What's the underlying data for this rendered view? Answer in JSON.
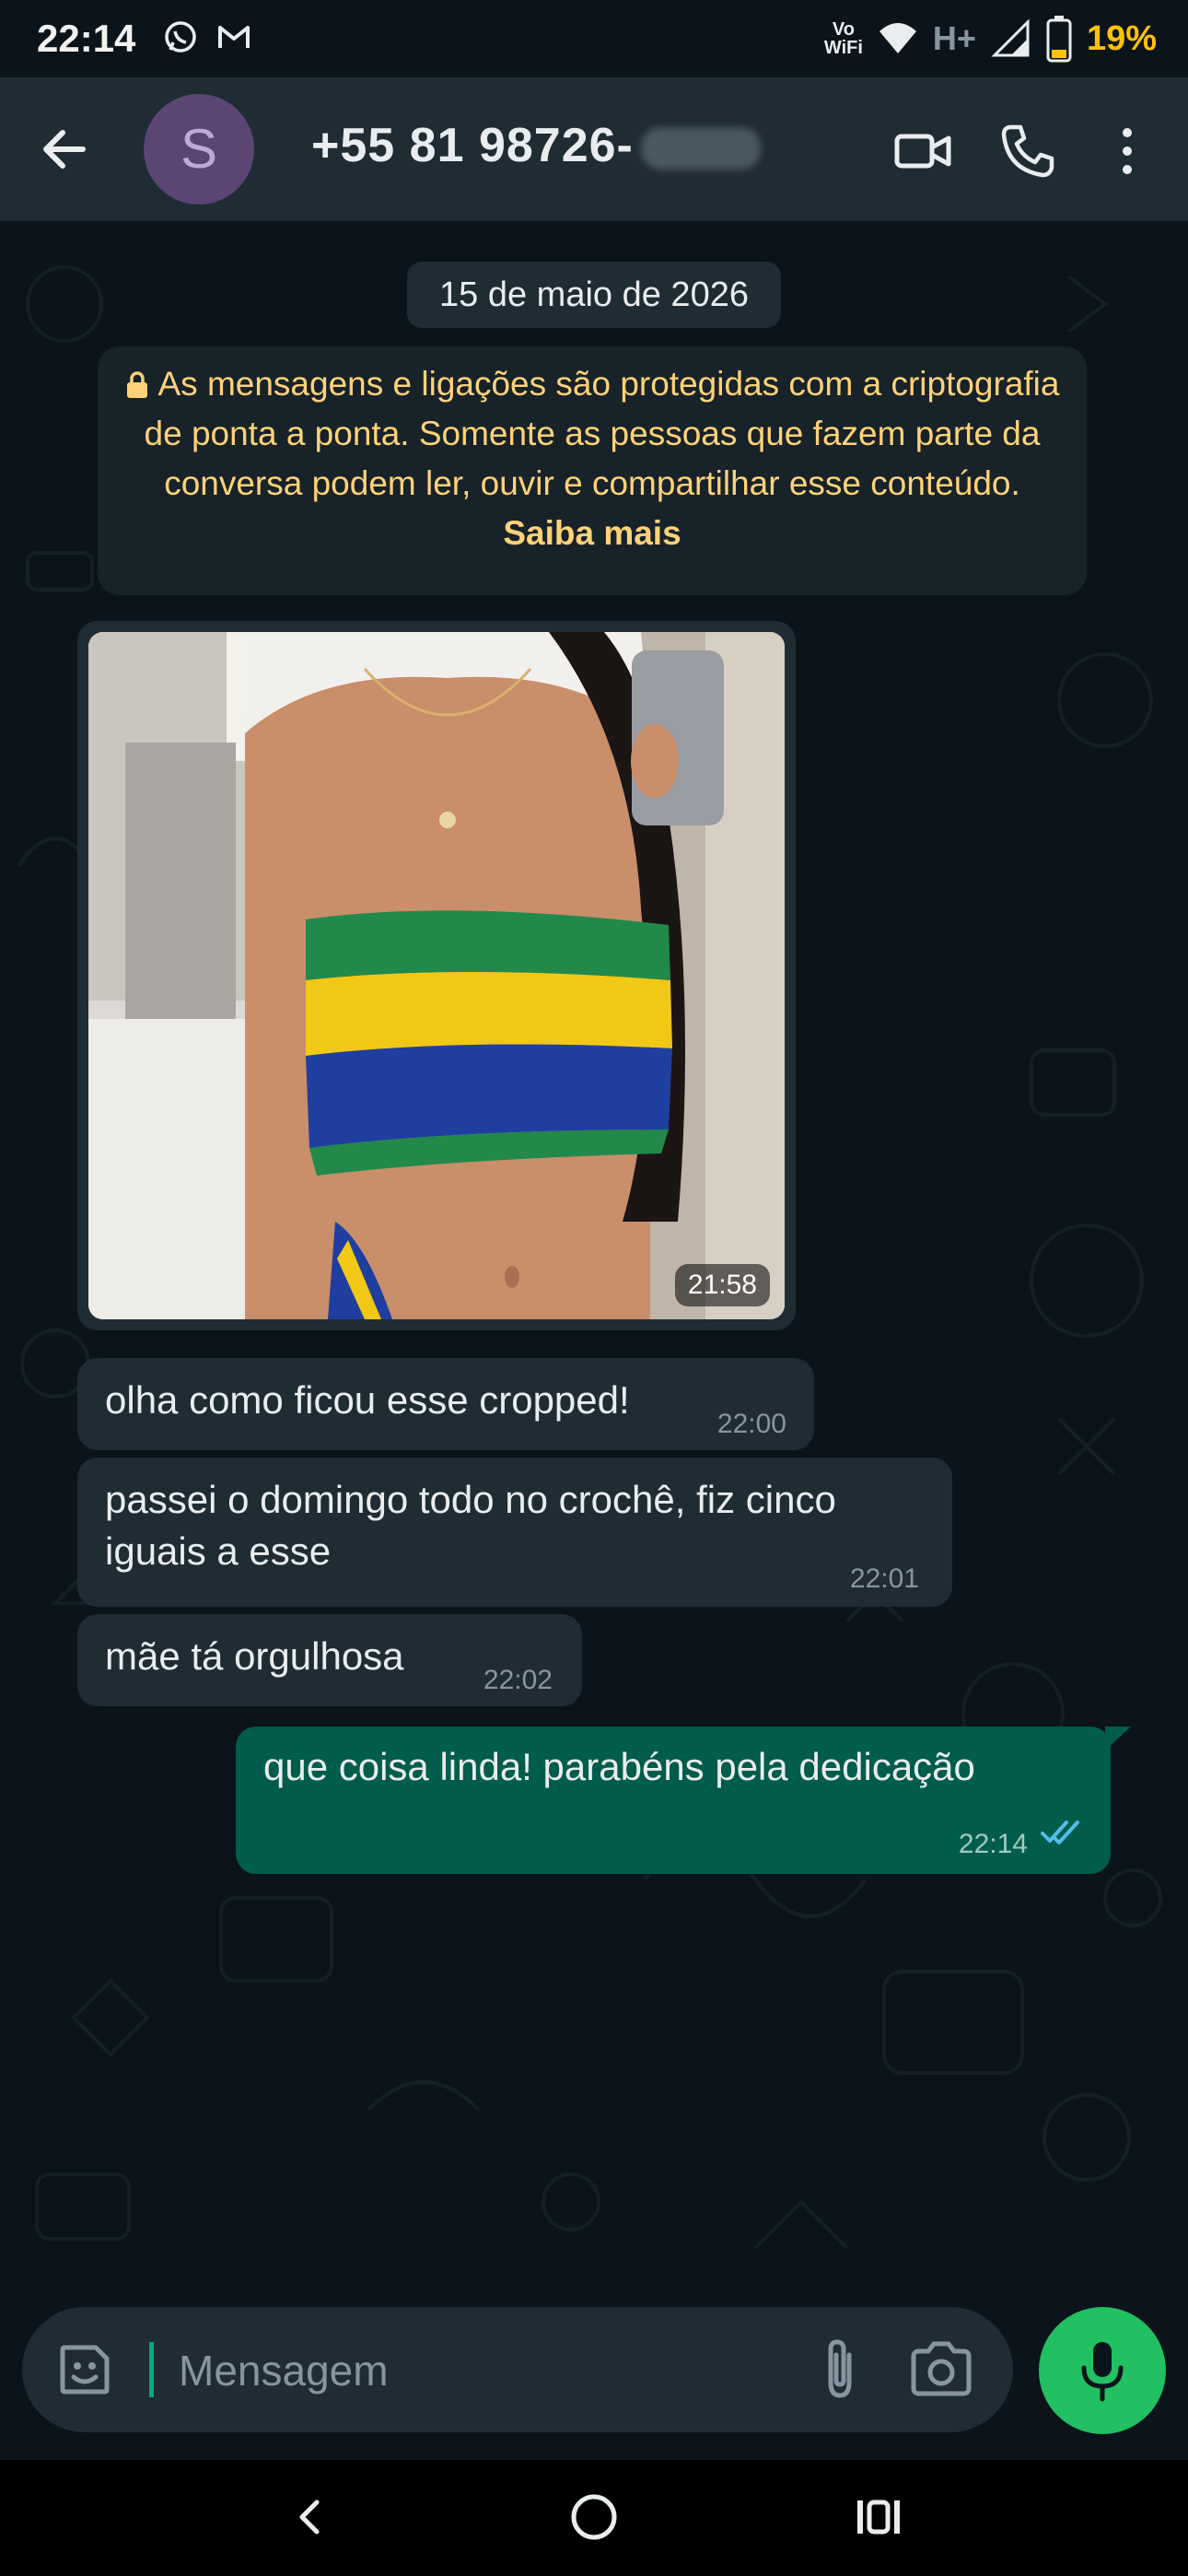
{
  "status_bar": {
    "time": "22:14",
    "network_label_top": "Vo",
    "network_label_bottom": "WiFi",
    "signal_type": "H+",
    "battery_percent": "19%",
    "icons": [
      "whatsapp-icon",
      "gmail-icon",
      "wifi-icon",
      "signal-icon",
      "battery-icon"
    ]
  },
  "header": {
    "avatar_letter": "S",
    "contact_name": "+55 81 98726-",
    "icons": [
      "back-arrow-icon",
      "video-call-icon",
      "phone-icon",
      "more-vert-icon"
    ]
  },
  "chat": {
    "date_label": "15 de maio de 2026",
    "encryption_notice": "As mensagens e ligações são protegidas com a criptografia de ponta a ponta. Somente as pessoas que fazem parte da conversa podem ler, ouvir e compartilhar esse conteúdo.",
    "encryption_link": "Saiba mais",
    "image_message": {
      "time": "21:58"
    },
    "messages": [
      {
        "text": "olha como ficou esse cropped!",
        "time": "22:00",
        "direction": "in"
      },
      {
        "text": "passei o domingo todo no crochê, fiz cinco iguais a esse",
        "time": "22:01",
        "direction": "in"
      },
      {
        "text": "mãe tá orgulhosa",
        "time": "22:02",
        "direction": "in"
      },
      {
        "text": "que coisa linda! parabéns pela dedicação",
        "time": "22:14",
        "direction": "out",
        "read": true
      }
    ]
  },
  "composer": {
    "placeholder": "Mensagem",
    "icons": [
      "sticker-icon",
      "attach-icon",
      "camera-icon",
      "mic-icon"
    ]
  },
  "colors": {
    "background": "#0b141a",
    "header": "#1f2c34",
    "incoming_bubble": "#1f2c34",
    "outgoing_bubble": "#005c4b",
    "accent": "#21c063",
    "notice_text": "#ffd279",
    "read_ticks": "#53bdeb",
    "battery": "#ffc107"
  }
}
